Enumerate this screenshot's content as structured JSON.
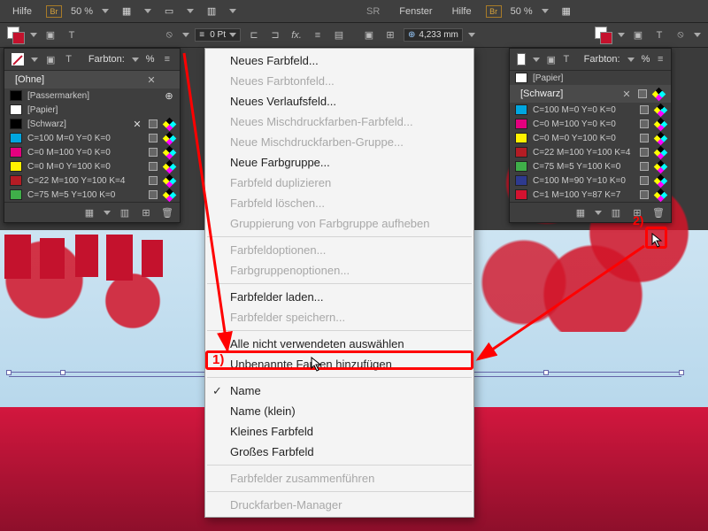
{
  "menubar_left": {
    "hilfe": "Hilfe",
    "br": "Br",
    "zoom": "50 %"
  },
  "menubar_right": {
    "sr": "SR",
    "fenster": "Fenster",
    "hilfe": "Hilfe",
    "br": "Br",
    "zoom": "50 %"
  },
  "optbar_left": {
    "pt": "0 Pt"
  },
  "optbar_right": {
    "wfield": "4,233 mm"
  },
  "tint_label": "Farbton:",
  "tint_pct": "%",
  "panel_left": {
    "title": "[Ohne]",
    "rows": [
      {
        "name": "[Passermarken]",
        "color": "#000000",
        "reg": true
      },
      {
        "name": "[Papier]",
        "color": "#ffffff"
      },
      {
        "name": "[Schwarz]",
        "color": "#000000",
        "lock": true
      },
      {
        "name": "C=100 M=0 Y=0 K=0",
        "color": "#00a6e0"
      },
      {
        "name": "C=0 M=100 Y=0 K=0",
        "color": "#e4007f"
      },
      {
        "name": "C=0 M=0 Y=100 K=0",
        "color": "#fff100"
      },
      {
        "name": "C=22 M=100 Y=100 K=4",
        "color": "#b41c24"
      },
      {
        "name": "C=75 M=5 Y=100 K=0",
        "color": "#3fae49"
      }
    ]
  },
  "panel_right": {
    "title_paper": "[Papier]",
    "title_black": "[Schwarz]",
    "rows": [
      {
        "name": "C=100 M=0 Y=0 K=0",
        "color": "#00a6e0"
      },
      {
        "name": "C=0 M=100 Y=0 K=0",
        "color": "#e4007f"
      },
      {
        "name": "C=0 M=0 Y=100 K=0",
        "color": "#fff100"
      },
      {
        "name": "C=22 M=100 Y=100 K=4",
        "color": "#b41c24"
      },
      {
        "name": "C=75 M=5 Y=100 K=0",
        "color": "#3fae49"
      },
      {
        "name": "C=100 M=90 Y=10 K=0",
        "color": "#2e3a8f"
      },
      {
        "name": "C=1 M=100 Y=87 K=7",
        "color": "#d41230"
      }
    ]
  },
  "ctx": {
    "items": [
      {
        "t": "Neues Farbfeld...",
        "en": true
      },
      {
        "t": "Neues Farbtonfeld...",
        "en": false
      },
      {
        "t": "Neues Verlaufsfeld...",
        "en": true
      },
      {
        "t": "Neues Mischdruckfarben-Farbfeld...",
        "en": false
      },
      {
        "t": "Neue Mischdruckfarben-Gruppe...",
        "en": false
      },
      {
        "t": "Neue Farbgruppe...",
        "en": true
      },
      {
        "t": "Farbfeld duplizieren",
        "en": false
      },
      {
        "t": "Farbfeld löschen...",
        "en": false
      },
      {
        "t": "Gruppierung von Farbgruppe aufheben",
        "en": false
      },
      {
        "sep": true
      },
      {
        "t": "Farbfeldoptionen...",
        "en": false
      },
      {
        "t": "Farbgruppenoptionen...",
        "en": false
      },
      {
        "sep": true
      },
      {
        "t": "Farbfelder laden...",
        "en": true
      },
      {
        "t": "Farbfelder speichern...",
        "en": false
      },
      {
        "sep": true
      },
      {
        "t": "Alle nicht verwendeten auswählen",
        "en": true
      },
      {
        "t": "Unbenannte Farben hinzufügen",
        "en": true
      },
      {
        "sep": true
      },
      {
        "t": "Name",
        "en": true,
        "check": true
      },
      {
        "t": "Name (klein)",
        "en": true
      },
      {
        "t": "Kleines Farbfeld",
        "en": true
      },
      {
        "t": "Großes Farbfeld",
        "en": true
      },
      {
        "sep": true
      },
      {
        "t": "Farbfelder zusammenführen",
        "en": false
      },
      {
        "sep": true
      },
      {
        "t": "Druckfarben-Manager",
        "en": false
      }
    ]
  },
  "anno": {
    "n1": "1)",
    "n2": "2)"
  }
}
